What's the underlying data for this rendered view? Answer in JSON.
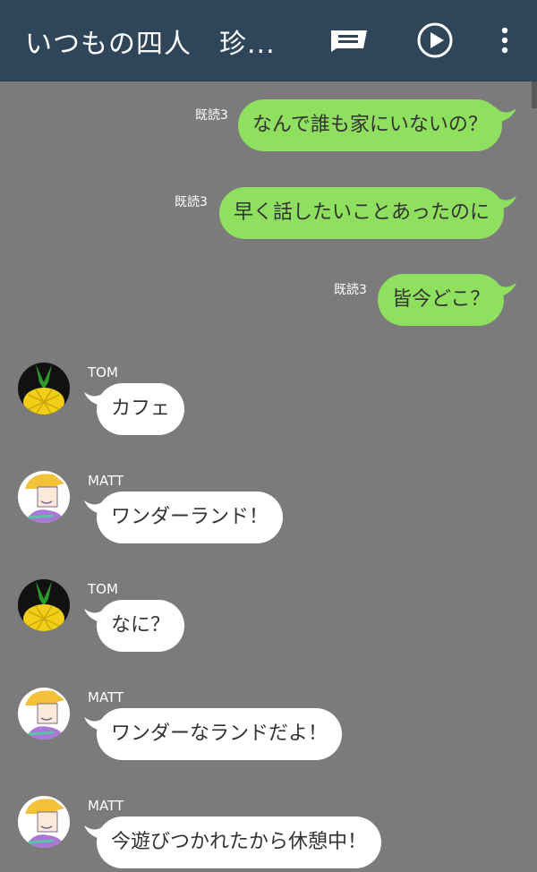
{
  "header": {
    "title": "いつもの四人　珍...",
    "icons": [
      "chat-bubble-icon",
      "play-icon",
      "more-vert-icon"
    ],
    "color": "#2f4559"
  },
  "colors": {
    "background": "#7b7b7b",
    "outgoing": "#8fe05e",
    "incoming": "#ffffff"
  },
  "messages": [
    {
      "direction": "out",
      "read": "既読3",
      "text": "なんで誰も家にいないの？"
    },
    {
      "direction": "out",
      "read": "既読3",
      "text": "早く話したいことあったのに"
    },
    {
      "direction": "out",
      "read": "既読3",
      "text": "皆今どこ？"
    },
    {
      "direction": "in",
      "sender": "TOM",
      "avatar": "pineapple-avatar",
      "text": "カフェ"
    },
    {
      "direction": "in",
      "sender": "MATT",
      "avatar": "blond-boy-avatar",
      "text": "ワンダーランド！"
    },
    {
      "direction": "in",
      "sender": "TOM",
      "avatar": "pineapple-avatar",
      "text": "なに？"
    },
    {
      "direction": "in",
      "sender": "MATT",
      "avatar": "blond-boy-avatar",
      "text": "ワンダーなランドだよ！"
    },
    {
      "direction": "in",
      "sender": "MATT",
      "avatar": "blond-boy-avatar",
      "text": "今遊びつかれたから休憩中！"
    }
  ]
}
